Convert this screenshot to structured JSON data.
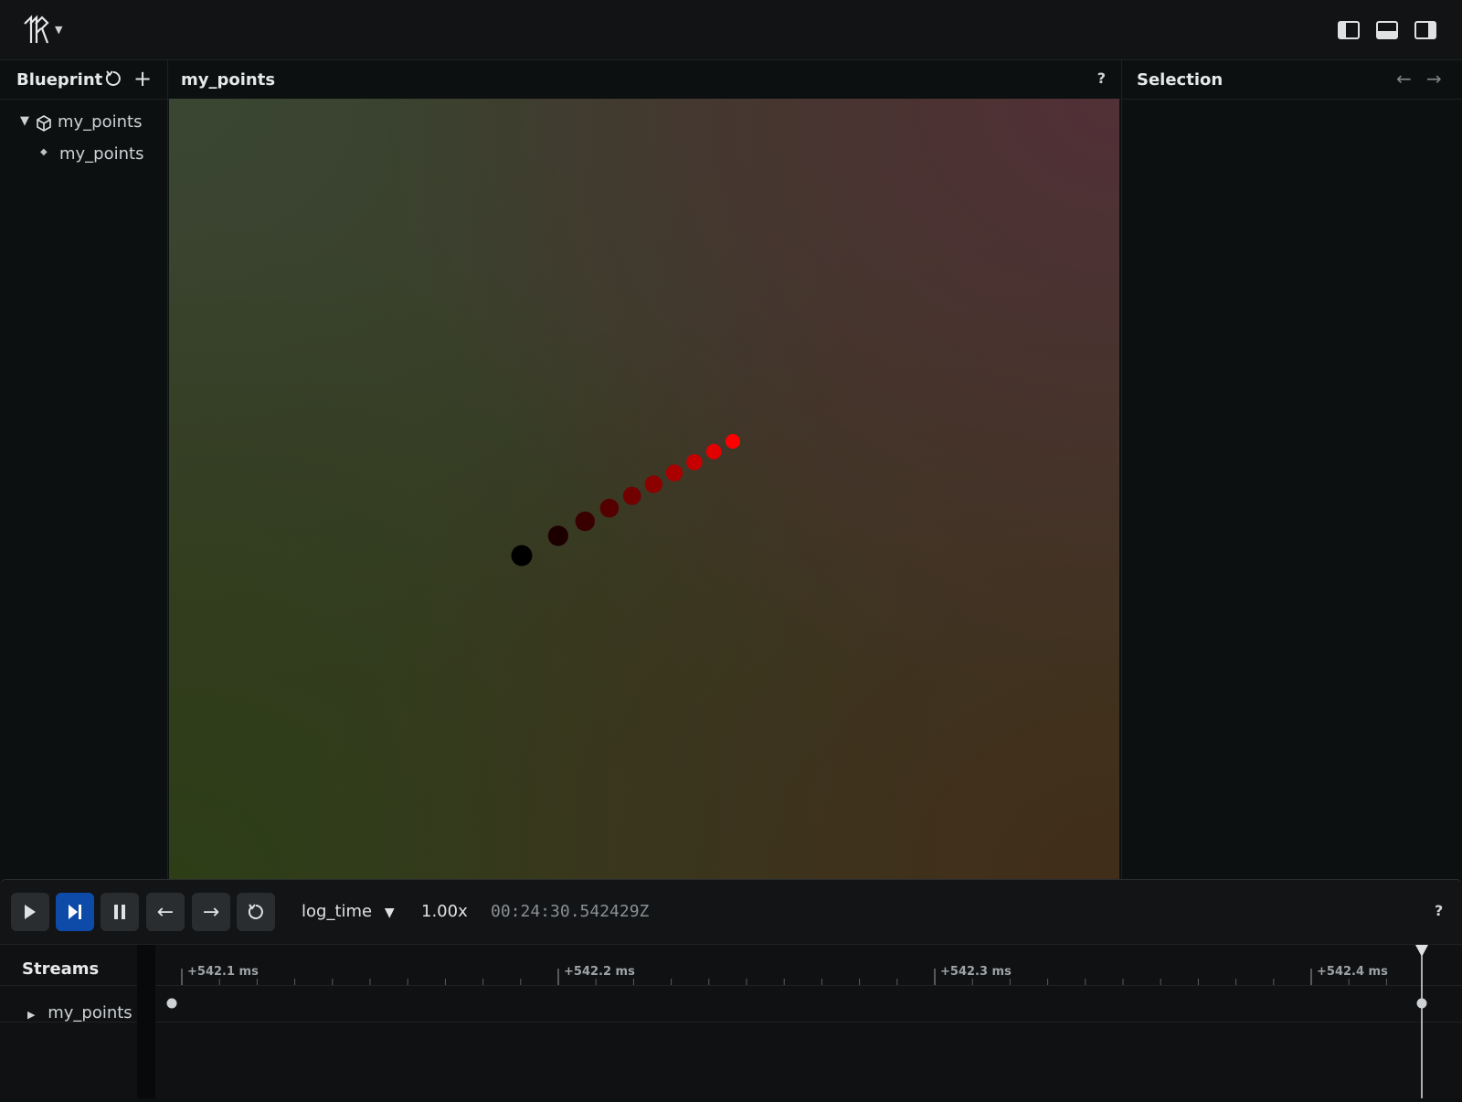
{
  "blueprint": {
    "title": "Blueprint",
    "tree": [
      {
        "label": "my_points",
        "kind": "space-view"
      },
      {
        "label": "my_points",
        "kind": "entity"
      }
    ]
  },
  "view": {
    "title": "my_points",
    "help": "?"
  },
  "selection": {
    "title": "Selection"
  },
  "playback": {
    "timeline": "log_time",
    "speed": "1.00x",
    "time": "00:24:30.542429Z",
    "help": "?"
  },
  "streams": {
    "title": "Streams",
    "rows": [
      {
        "label": "my_points"
      }
    ],
    "ticks": [
      "+542.1 ms",
      "+542.2 ms",
      "+542.3 ms",
      "+542.4 ms"
    ]
  },
  "points": {
    "count": 10,
    "colors": [
      "#000000",
      "#1c0000",
      "#380000",
      "#550000",
      "#710000",
      "#8d0000",
      "#aa0000",
      "#c60000",
      "#e20000",
      "#ff0000"
    ]
  },
  "colors": {
    "accent": "#0e4ba8",
    "background": "#0d1011"
  }
}
